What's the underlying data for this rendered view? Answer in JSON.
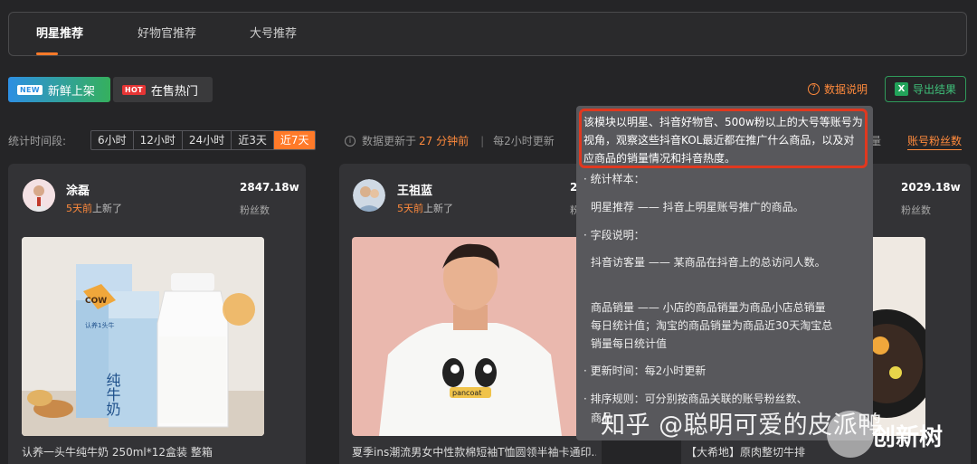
{
  "tabs": [
    {
      "label": "明星推荐",
      "active": true
    },
    {
      "label": "好物官推荐",
      "active": false
    },
    {
      "label": "大号推荐",
      "active": false
    }
  ],
  "filters": {
    "new_badge": "NEW",
    "new_label": "新鲜上架",
    "hot_badge": "HOT",
    "hot_label": "在售热门"
  },
  "actions": {
    "data_desc": "数据说明",
    "export": "导出结果"
  },
  "period": {
    "label": "统计时间段:",
    "options": [
      "6小时",
      "12小时",
      "24小时",
      "近3天",
      "近7天"
    ],
    "selected": "近7天"
  },
  "update": {
    "prefix": "数据更新于",
    "num": "27 分钟前",
    "freq": "每2小时更新",
    "tail": "量"
  },
  "sort": {
    "fans": "账号粉丝数"
  },
  "cards": [
    {
      "name": "涂磊",
      "updated_hl": "5天前",
      "updated_suffix": "上新了",
      "fans": "2847.18w",
      "fans_label": "粉丝数",
      "product_title": "认养一头牛纯牛奶 250ml*12盒装 整箱"
    },
    {
      "name": "王祖蓝",
      "updated_hl": "5天前",
      "updated_suffix": "上新了",
      "fans": "2",
      "fans_label": "粉",
      "product_title": "夏季ins潮流男女中性款棉短袖T恤圆领半袖卡通印..."
    },
    {
      "name": "",
      "updated_hl": "",
      "updated_suffix": "",
      "fans": "2029.18w",
      "fans_label": "粉丝数",
      "product_title": "【大希地】原肉整切牛排"
    }
  ],
  "product_art": {
    "milk_brand": "COW",
    "milk_sub": "认养1头牛",
    "milk_label": "纯牛奶",
    "shirt_text": "pancoat"
  },
  "tooltip": {
    "intro": "该模块以明星、抖音好物官、500w粉以上的大号等账号为视角，观察这些抖音KOL最近都在推广什么商品，以及对应商品的销量情况和抖音热度。",
    "sample_head": "· 统计样本：",
    "sample_body": "明星推荐 —— 抖音上明星账号推广的商品。",
    "field_head": "· 字段说明：",
    "field_1": "抖音访客量 —— 某商品在抖音上的总访问人数。",
    "field_2": "商品销量 —— 小店的商品销量为商品小店总销量每日统计值；淘宝的商品销量为商品近30天淘宝总销量每日统计值",
    "time_line": "· 更新时间：每2小时更新",
    "rule_line": "· 排序规则：可分别按商品关联的账号粉丝数、",
    "rule_line_2": "商品"
  },
  "watermark": "知乎 @聪明可爱的皮派鸭",
  "brand_mark": "创新树"
}
